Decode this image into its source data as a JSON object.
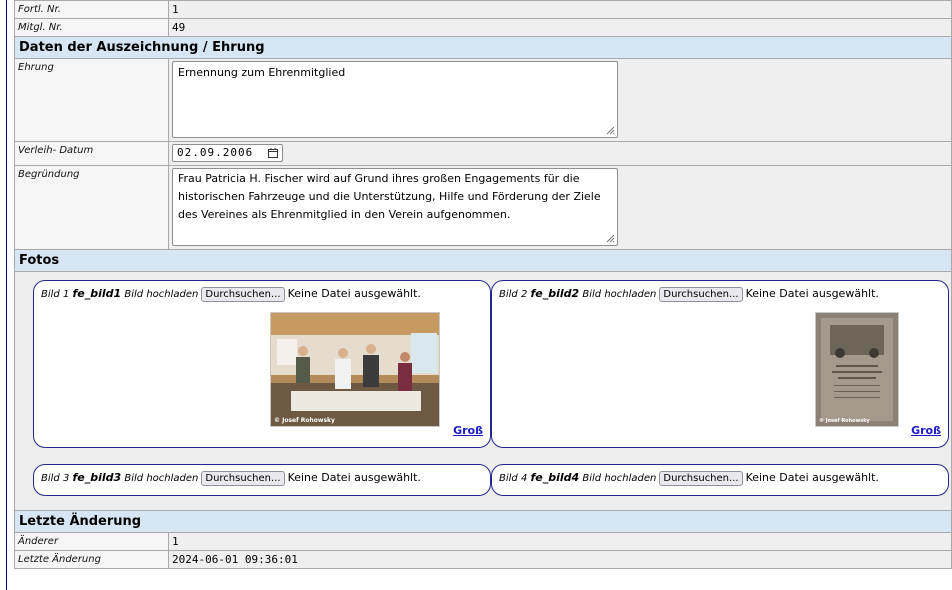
{
  "fields": {
    "fortl_nr_label": "Fortl. Nr.",
    "fortl_nr_value": "1",
    "mitgl_nr_label": "Mitgl. Nr.",
    "mitgl_nr_value": "49"
  },
  "section_auszeichnung": {
    "title": "Daten der Auszeichnung / Ehrung",
    "ehrung_label": "Ehrung",
    "ehrung_value": "Ernennung zum Ehrenmitglied",
    "verleih_label": "Verleih- Datum",
    "verleih_value": "02.09.2006",
    "begruendung_label": "Begründung",
    "begruendung_value": "Frau Patricia H. Fischer wird auf Grund ihres großen Engagements für die historischen Fahrzeuge und die Unterstützung, Hilfe und Förderung der Ziele des Vereines als Ehrenmitglied in den Verein aufgenommen."
  },
  "section_fotos": {
    "title": "Fotos",
    "photos": [
      {
        "prefix": "Bild 1",
        "field": "fe_bild1",
        "upload_label": "Bild hochladen",
        "button": "Durchsuchen...",
        "status": "Keine Datei ausgewählt.",
        "link": "Groß",
        "credit": "© Josef Rohowsky"
      },
      {
        "prefix": "Bild 2",
        "field": "fe_bild2",
        "upload_label": "Bild hochladen",
        "button": "Durchsuchen...",
        "status": "Keine Datei ausgewählt.",
        "link": "Groß",
        "credit": "© Josef Rohowsky"
      },
      {
        "prefix": "Bild 3",
        "field": "fe_bild3",
        "upload_label": "Bild hochladen",
        "button": "Durchsuchen...",
        "status": "Keine Datei ausgewählt."
      },
      {
        "prefix": "Bild 4",
        "field": "fe_bild4",
        "upload_label": "Bild hochladen",
        "button": "Durchsuchen...",
        "status": "Keine Datei ausgewählt."
      }
    ]
  },
  "section_aenderung": {
    "title": "Letzte Änderung",
    "aenderer_label": "Änderer",
    "aenderer_value": "1",
    "letzte_label": "Letzte Änderung",
    "letzte_value": "2024-06-01 09:36:01"
  },
  "colors": {
    "section_bg": "#d6e6f4",
    "box_border": "#24288e",
    "link": "#1a1ac8"
  }
}
